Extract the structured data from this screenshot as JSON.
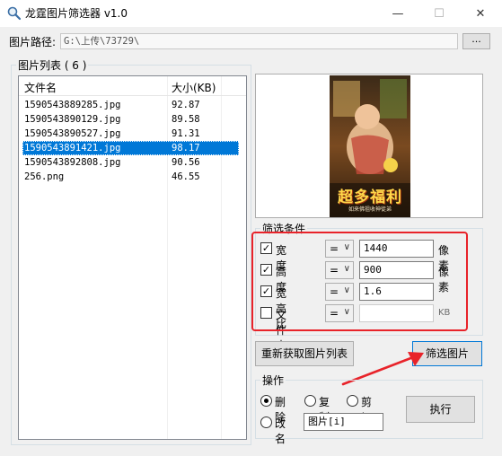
{
  "window": {
    "title": "龙霆图片筛选器 v1.0",
    "minimize": "—",
    "maximize": "☐",
    "close": "✕"
  },
  "path": {
    "label": "图片路径:",
    "value": "G:\\上传\\73729\\",
    "browse_label": "..."
  },
  "list": {
    "group_label": "图片列表 ( 6 )",
    "columns": [
      "文件名",
      "大小(KB)"
    ],
    "rows": [
      {
        "name": "1590543889285.jpg",
        "size": "92.87",
        "selected": false
      },
      {
        "name": "1590543890129.jpg",
        "size": "89.58",
        "selected": false
      },
      {
        "name": "1590543890527.jpg",
        "size": "91.31",
        "selected": false
      },
      {
        "name": "1590543891421.jpg",
        "size": "98.17",
        "selected": true
      },
      {
        "name": "1590543892808.jpg",
        "size": "90.56",
        "selected": false
      },
      {
        "name": "256.png",
        "size": "46.55",
        "selected": false
      }
    ]
  },
  "preview": {
    "image_text": "超多福利",
    "image_subtext": "如来佛祖收神徒弟"
  },
  "filter": {
    "group_label": "筛选条件",
    "conditions": [
      {
        "label": "宽度",
        "checked": true,
        "op": "=",
        "value": "1440",
        "unit": "像素"
      },
      {
        "label": "高度",
        "checked": true,
        "op": "=",
        "value": "900",
        "unit": "像素"
      },
      {
        "label": "宽高比",
        "checked": true,
        "op": "=",
        "value": "1.6",
        "unit": ""
      },
      {
        "label": "文件大小",
        "checked": false,
        "op": "=",
        "value": "",
        "unit": "KB"
      }
    ]
  },
  "buttons": {
    "refresh": "重新获取图片列表",
    "filter": "筛选图片",
    "execute": "执行"
  },
  "operation": {
    "group_label": "操作",
    "options": [
      {
        "label": "删除",
        "selected": true
      },
      {
        "label": "复制",
        "selected": false
      },
      {
        "label": "剪切",
        "selected": false
      },
      {
        "label": "改名",
        "selected": false
      }
    ],
    "rename_value": "图片[i]"
  },
  "colors": {
    "selection": "#0078d7",
    "annotation": "#e8232a"
  }
}
